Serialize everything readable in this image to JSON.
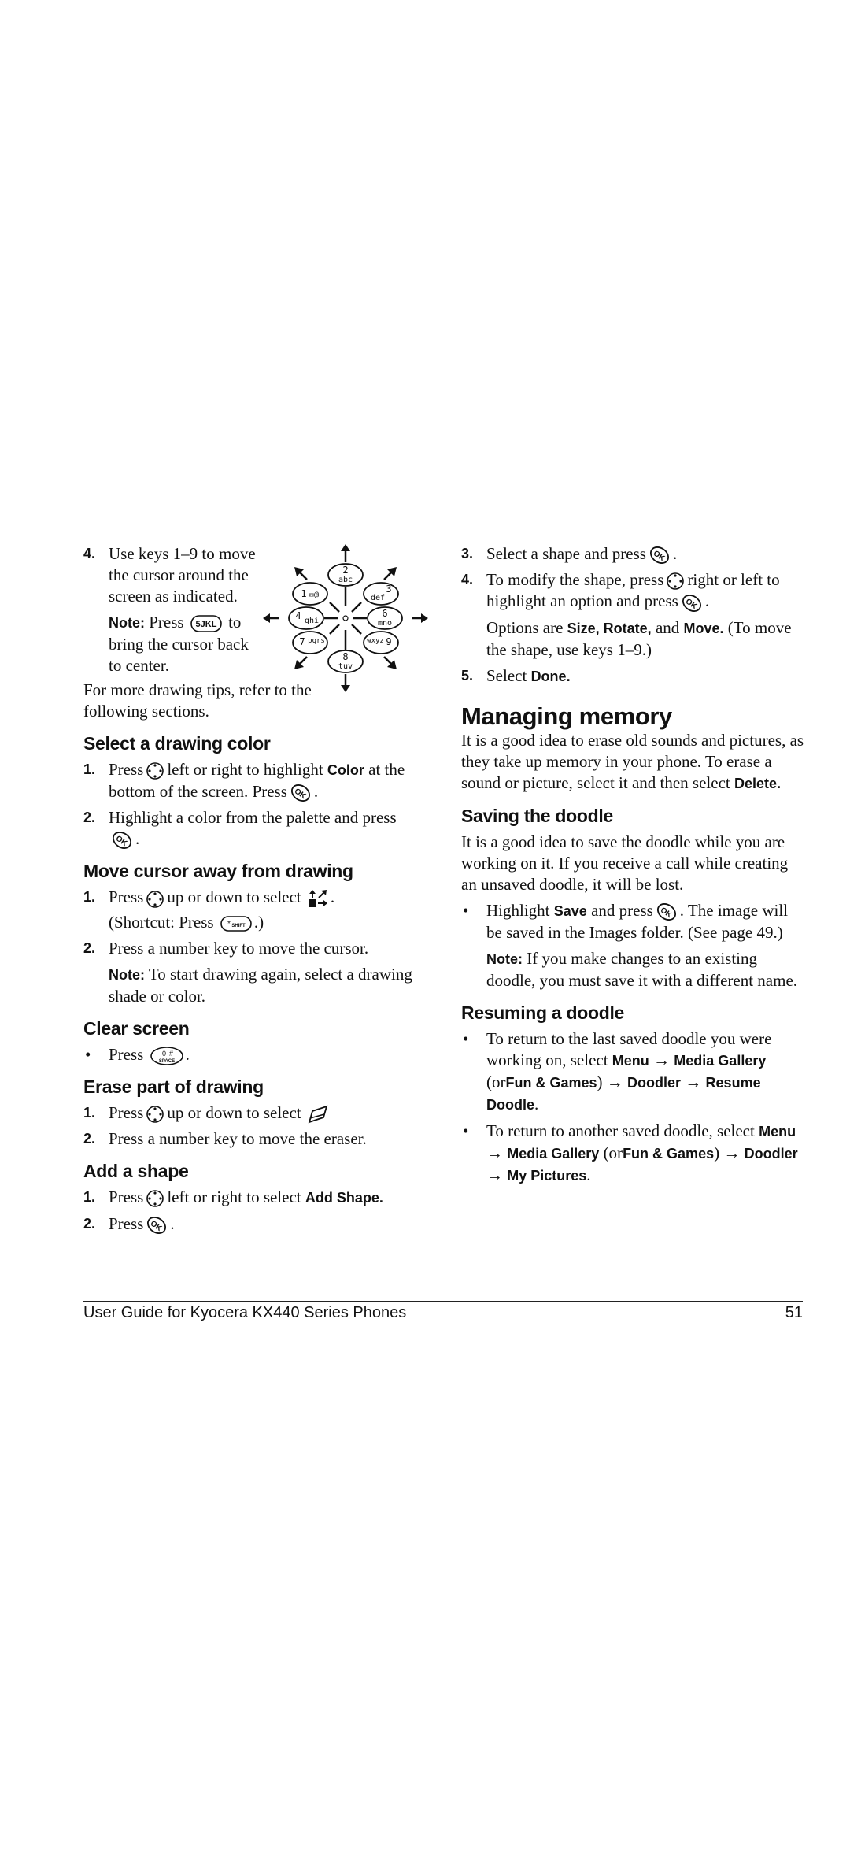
{
  "left": {
    "step4": {
      "num": "4.",
      "text": "Use keys 1–9 to move the cursor around the screen as indicated.",
      "note_label": "Note:",
      "note_pre": "Press",
      "note_post": "to bring the cursor back to center."
    },
    "keypad": {
      "keys": [
        {
          "digit": "1",
          "letters": "✉@"
        },
        {
          "digit": "2",
          "letters": "abc"
        },
        {
          "digit": "3",
          "letters": "def"
        },
        {
          "digit": "4",
          "letters": "ghi"
        },
        {
          "digit": "6",
          "letters": "mno"
        },
        {
          "digit": "7",
          "letters": "pqrs"
        },
        {
          "digit": "8",
          "letters": "tuv"
        },
        {
          "digit": "9",
          "letters": "wxyz"
        }
      ],
      "key5_label": "5JKL"
    },
    "intro": "For more drawing tips, refer to the following sections.",
    "sections": {
      "color": {
        "title": "Select a drawing color",
        "s1_num": "1.",
        "s1_pre": "Press",
        "s1_mid": "left or right to highlight",
        "s1_kw": "Color",
        "s1_post": "at the bottom of the screen. Press",
        "s1_end": ".",
        "s2_num": "2.",
        "s2_text": "Highlight a color from the palette and press",
        "s2_end": "."
      },
      "move": {
        "title": "Move cursor away from drawing",
        "s1_num": "1.",
        "s1_pre": "Press",
        "s1_mid": "up or down to select",
        "s1_end": ".",
        "shortcut_pre": "(Shortcut: Press",
        "shortcut_post": ".)",
        "s2_num": "2.",
        "s2_text": "Press a number key to move the cursor.",
        "note_label": "Note:",
        "note_text": "To start drawing again, select a drawing shade or color."
      },
      "clear": {
        "title": "Clear screen",
        "bullet": "•",
        "b1_pre": "Press",
        "b1_end": "."
      },
      "erase": {
        "title": "Erase part of drawing",
        "s1_num": "1.",
        "s1_pre": "Press",
        "s1_mid": "up or down to select",
        "s2_num": "2.",
        "s2_text": "Press a number key to move the eraser."
      },
      "shape": {
        "title": "Add a shape",
        "s1_num": "1.",
        "s1_pre": "Press",
        "s1_mid": "left or right to select",
        "s1_kw": "Add Shape.",
        "s2_num": "2.",
        "s2_pre": "Press",
        "s2_end": "."
      }
    }
  },
  "right": {
    "shape_cont": {
      "s3_num": "3.",
      "s3_text": "Select a shape and press",
      "s3_end": ".",
      "s4_num": "4.",
      "s4_pre": "To modify the shape, press",
      "s4_mid": "right or left to highlight an option and press",
      "s4_end": ".",
      "options_pre": "Options are",
      "options_kw": "Size, Rotate,",
      "options_and": "and",
      "options_kw2": "Move.",
      "options_post": "(To move the shape, use keys 1–9.)",
      "s5_num": "5.",
      "s5_pre": "Select",
      "s5_kw": "Done."
    },
    "memory": {
      "title": "Managing memory",
      "body_pre": "It is a good idea to erase old sounds and pictures, as they take up memory in your phone. To erase a sound or picture, select it and then select",
      "body_kw": "Delete."
    },
    "saving": {
      "title": "Saving the doodle",
      "body": "It is a good idea to save the doodle while you are working on it. If you receive a call while creating an unsaved doodle, it will be lost.",
      "bullet": "•",
      "b1_pre": "Highlight",
      "b1_kw": "Save",
      "b1_mid": "and press",
      "b1_post": ". The image will be saved in the Images folder. (See page 49.)",
      "note_label": "Note:",
      "note_text": "If you make changes to an existing doodle, you must save it with a different name."
    },
    "resuming": {
      "title": "Resuming a doodle",
      "bullet": "•",
      "b1_pre": "To return to the last saved doodle you were working on, select",
      "b1_path": [
        "Menu",
        "Media Gallery",
        "Fun & Games",
        "Doodler",
        "Resume Doodle"
      ],
      "b2_pre": "To return to another saved doodle, select",
      "b2_path": [
        "Menu",
        "Media Gallery",
        "Fun & Games",
        "Doodler",
        "My Pictures"
      ],
      "arrow": "→",
      "or_open": "(or",
      "or_close": ")"
    }
  },
  "footer": {
    "title": "User Guide for Kyocera KX440 Series Phones",
    "page": "51"
  }
}
